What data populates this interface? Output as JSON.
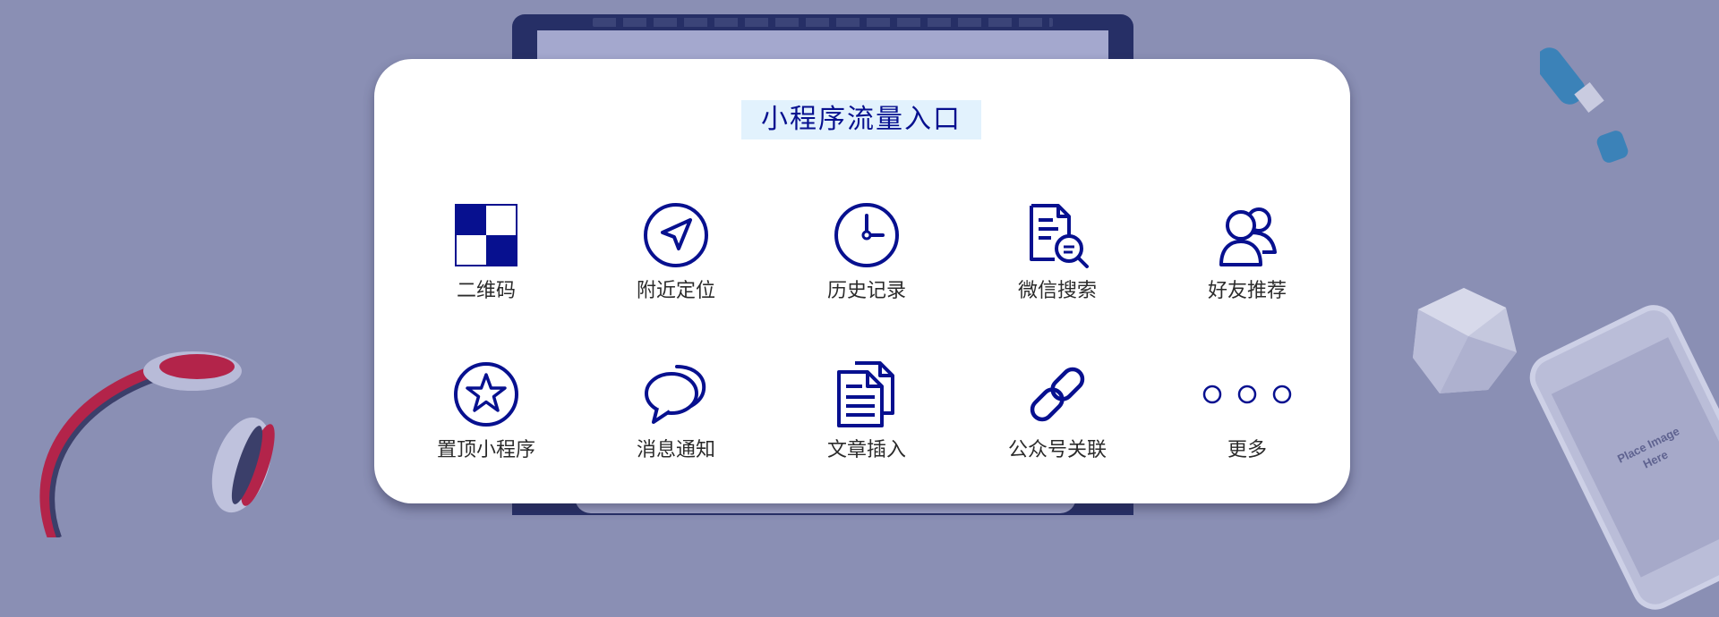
{
  "title": "小程序流量入口",
  "items": [
    {
      "label": "二维码",
      "icon": "qr-code-icon"
    },
    {
      "label": "附近定位",
      "icon": "location-arrow-icon"
    },
    {
      "label": "历史记录",
      "icon": "clock-icon"
    },
    {
      "label": "微信搜索",
      "icon": "document-search-icon"
    },
    {
      "label": "好友推荐",
      "icon": "friends-icon"
    },
    {
      "label": "置顶小程序",
      "icon": "star-icon"
    },
    {
      "label": "消息通知",
      "icon": "chat-bubbles-icon"
    },
    {
      "label": "文章插入",
      "icon": "documents-icon"
    },
    {
      "label": "公众号关联",
      "icon": "link-icon"
    },
    {
      "label": "更多",
      "icon": "more-dots-icon"
    }
  ],
  "phone_placeholder": {
    "line1": "Place Image",
    "line2": "Here"
  },
  "colors": {
    "background": "#8a8fb4",
    "card": "#ffffff",
    "accent": "#07108f",
    "title_highlight": "#e2f2fd"
  }
}
